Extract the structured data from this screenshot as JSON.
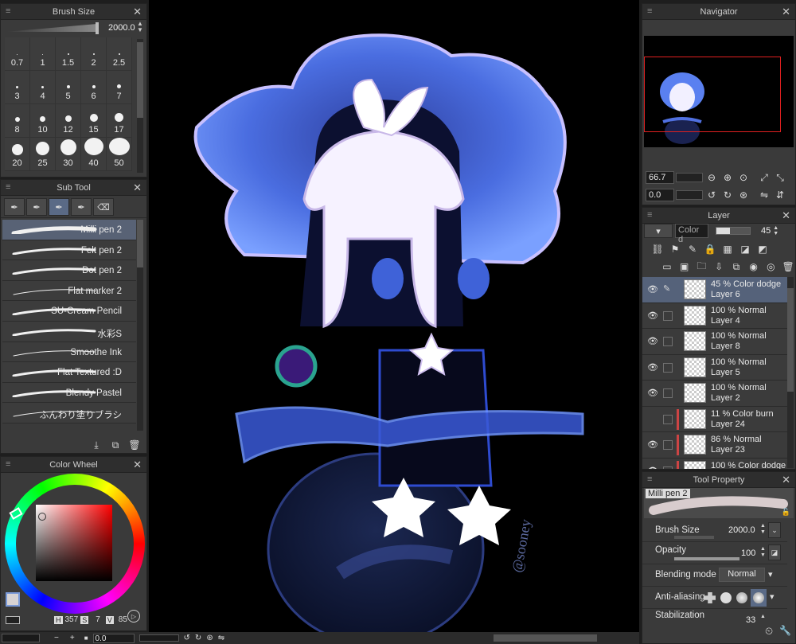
{
  "brush_size": {
    "title": "Brush Size",
    "value": "2000.0",
    "sizes": [
      {
        "label": "0.7",
        "d": 1
      },
      {
        "label": "1",
        "d": 1
      },
      {
        "label": "1.5",
        "d": 2
      },
      {
        "label": "2",
        "d": 2
      },
      {
        "label": "2.5",
        "d": 2
      },
      {
        "label": "3",
        "d": 3
      },
      {
        "label": "4",
        "d": 3
      },
      {
        "label": "5",
        "d": 4
      },
      {
        "label": "6",
        "d": 4
      },
      {
        "label": "7",
        "d": 5
      },
      {
        "label": "8",
        "d": 6
      },
      {
        "label": "10",
        "d": 7
      },
      {
        "label": "12",
        "d": 8
      },
      {
        "label": "15",
        "d": 10
      },
      {
        "label": "17",
        "d": 11
      },
      {
        "label": "20",
        "d": 14
      },
      {
        "label": "25",
        "d": 17
      },
      {
        "label": "30",
        "d": 20
      },
      {
        "label": "40",
        "d": 24
      },
      {
        "label": "50",
        "d": 26
      }
    ]
  },
  "sub_tool": {
    "title": "Sub Tool",
    "items": [
      {
        "label": "Milli pen 2",
        "selected": true
      },
      {
        "label": "Felt pen 2",
        "selected": false
      },
      {
        "label": "Dot pen 2",
        "selected": false
      },
      {
        "label": "Flat marker 2",
        "selected": false
      },
      {
        "label": "SU-Cream Pencil",
        "selected": false
      },
      {
        "label": "水彩S",
        "selected": false
      },
      {
        "label": "Smoothe Ink",
        "selected": false
      },
      {
        "label": "Flat Textured :D",
        "selected": false
      },
      {
        "label": "Blendy Pastel",
        "selected": false
      },
      {
        "label": "ふんわり塗りブラシ",
        "selected": false
      }
    ]
  },
  "color_wheel": {
    "title": "Color Wheel",
    "h_label": "H",
    "h": "357",
    "s_label": "S",
    "s": "7",
    "v_label": "V",
    "v": "85"
  },
  "navigator": {
    "title": "Navigator",
    "zoom": "66.7",
    "rotation": "0.0"
  },
  "layer": {
    "title": "Layer",
    "blend": "Color d",
    "opacity": "45",
    "items": [
      {
        "mode": "45 % Color dodge",
        "name": "Layer 6",
        "visible": true,
        "selected": true,
        "red": false
      },
      {
        "mode": "100 % Normal",
        "name": "Layer 4",
        "visible": true,
        "selected": false,
        "red": false
      },
      {
        "mode": "100 % Normal",
        "name": "Layer 8",
        "visible": true,
        "selected": false,
        "red": false
      },
      {
        "mode": "100 % Normal",
        "name": "Layer 5",
        "visible": true,
        "selected": false,
        "red": false
      },
      {
        "mode": "100 % Normal",
        "name": "Layer 2",
        "visible": true,
        "selected": false,
        "red": false
      },
      {
        "mode": "11 % Color burn",
        "name": "Layer 24",
        "visible": false,
        "selected": false,
        "red": true
      },
      {
        "mode": "86 % Normal",
        "name": "Layer 23",
        "visible": true,
        "selected": false,
        "red": true
      },
      {
        "mode": "100 % Color dodge",
        "name": "",
        "visible": true,
        "selected": false,
        "red": true
      }
    ]
  },
  "tool_property": {
    "title": "Tool Property",
    "tool_name": "Milli pen 2",
    "brush_size_label": "Brush Size",
    "brush_size": "2000.0",
    "opacity_label": "Opacity",
    "opacity": "100",
    "blending_label": "Blending mode",
    "blending": "Normal",
    "anti_alias_label": "Anti-aliasing",
    "stabilization_label": "Stabilization",
    "stabilization": "33"
  },
  "statusbar": {
    "rotation": "0.0"
  },
  "canvas": {
    "signature": "@sooney"
  }
}
